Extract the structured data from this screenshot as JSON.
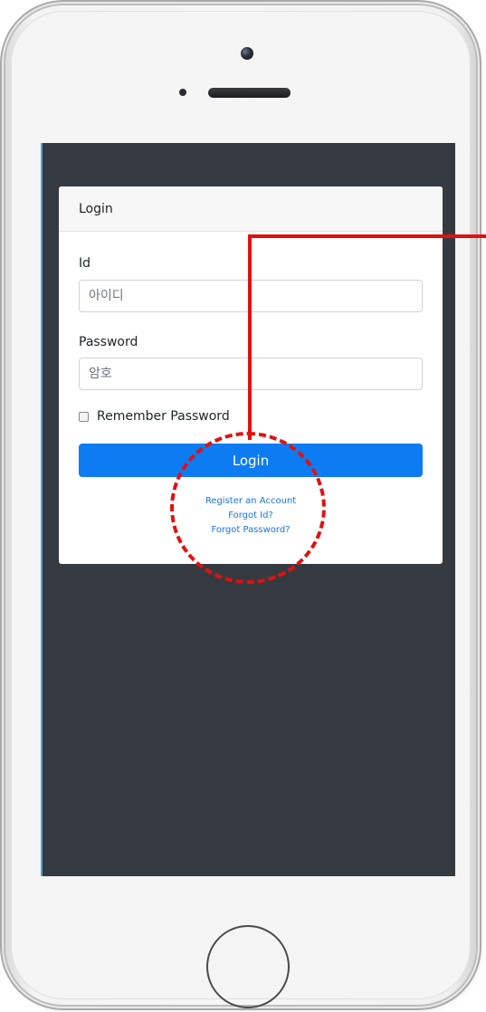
{
  "card": {
    "header_title": "Login"
  },
  "form": {
    "id_label": "Id",
    "id_placeholder": "아이디",
    "password_label": "Password",
    "password_placeholder": "암호",
    "remember_label": "Remember Password",
    "login_button": "Login"
  },
  "links": {
    "register": "Register an Account",
    "forgot_id": "Forgot Id?",
    "forgot_password": "Forgot Password?"
  },
  "colors": {
    "screen_bg": "#343a40",
    "primary_button": "#0d7cf2",
    "link": "#1a73e8",
    "annotation": "#e31010"
  }
}
